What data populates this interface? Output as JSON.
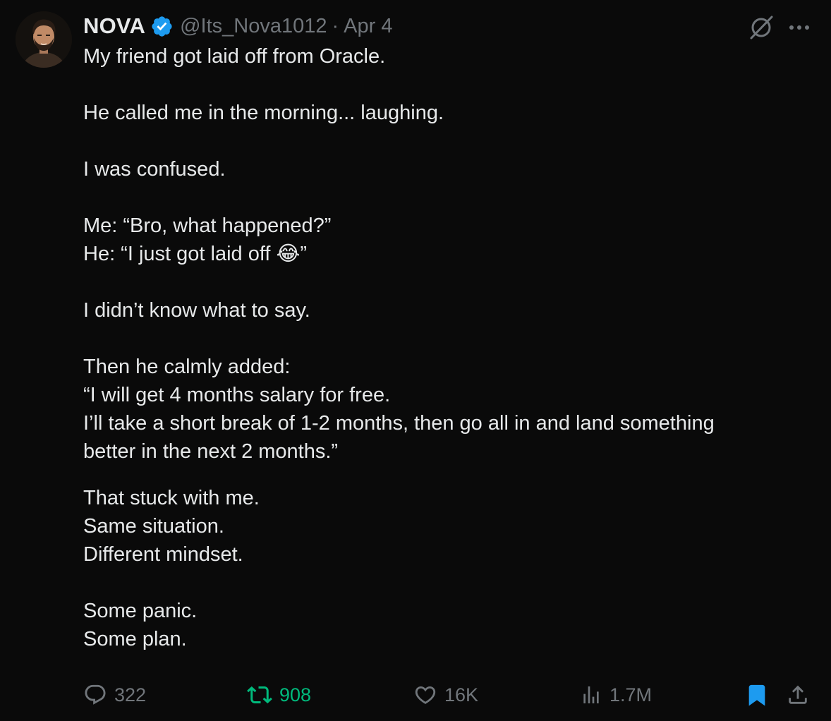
{
  "author": {
    "name": "NOVA",
    "handle": "@Its_Nova1012",
    "separator": "·",
    "date": "Apr 4",
    "verified": true,
    "verified_color": "#1d9bf0"
  },
  "body_lines": [
    "My friend got laid off from Oracle.",
    "",
    "He called me in the morning... laughing.",
    "",
    "I was confused.",
    "",
    "Me: “Bro, what happened?”",
    "He: “I just got laid off 😂”",
    "",
    "I didn’t know what to say.",
    "",
    "Then he calmly added:",
    "“I will get 4 months salary for free.",
    "I’ll take a short break of 1-2 months, then go all in and land something",
    "better in the next 2 months.”",
    "",
    "That stuck with me.",
    "Same situation.",
    "Different mindset.",
    "",
    "Some panic.",
    "Some plan."
  ],
  "actions": {
    "replies": {
      "icon": "reply-icon",
      "count": "322"
    },
    "retweets": {
      "icon": "retweet-icon",
      "count": "908",
      "active": true,
      "color": "#00ba7c"
    },
    "likes": {
      "icon": "heart-icon",
      "count": "16K"
    },
    "views": {
      "icon": "views-icon",
      "count": "1.7M"
    },
    "bookmark": {
      "icon": "bookmark-icon",
      "active": true,
      "color": "#1d9bf0"
    },
    "share": {
      "icon": "share-icon"
    }
  },
  "colors": {
    "background": "#0a0a0a",
    "text": "#e7e9ea",
    "muted": "#71767b",
    "accent_blue": "#1d9bf0",
    "accent_green": "#00ba7c"
  }
}
